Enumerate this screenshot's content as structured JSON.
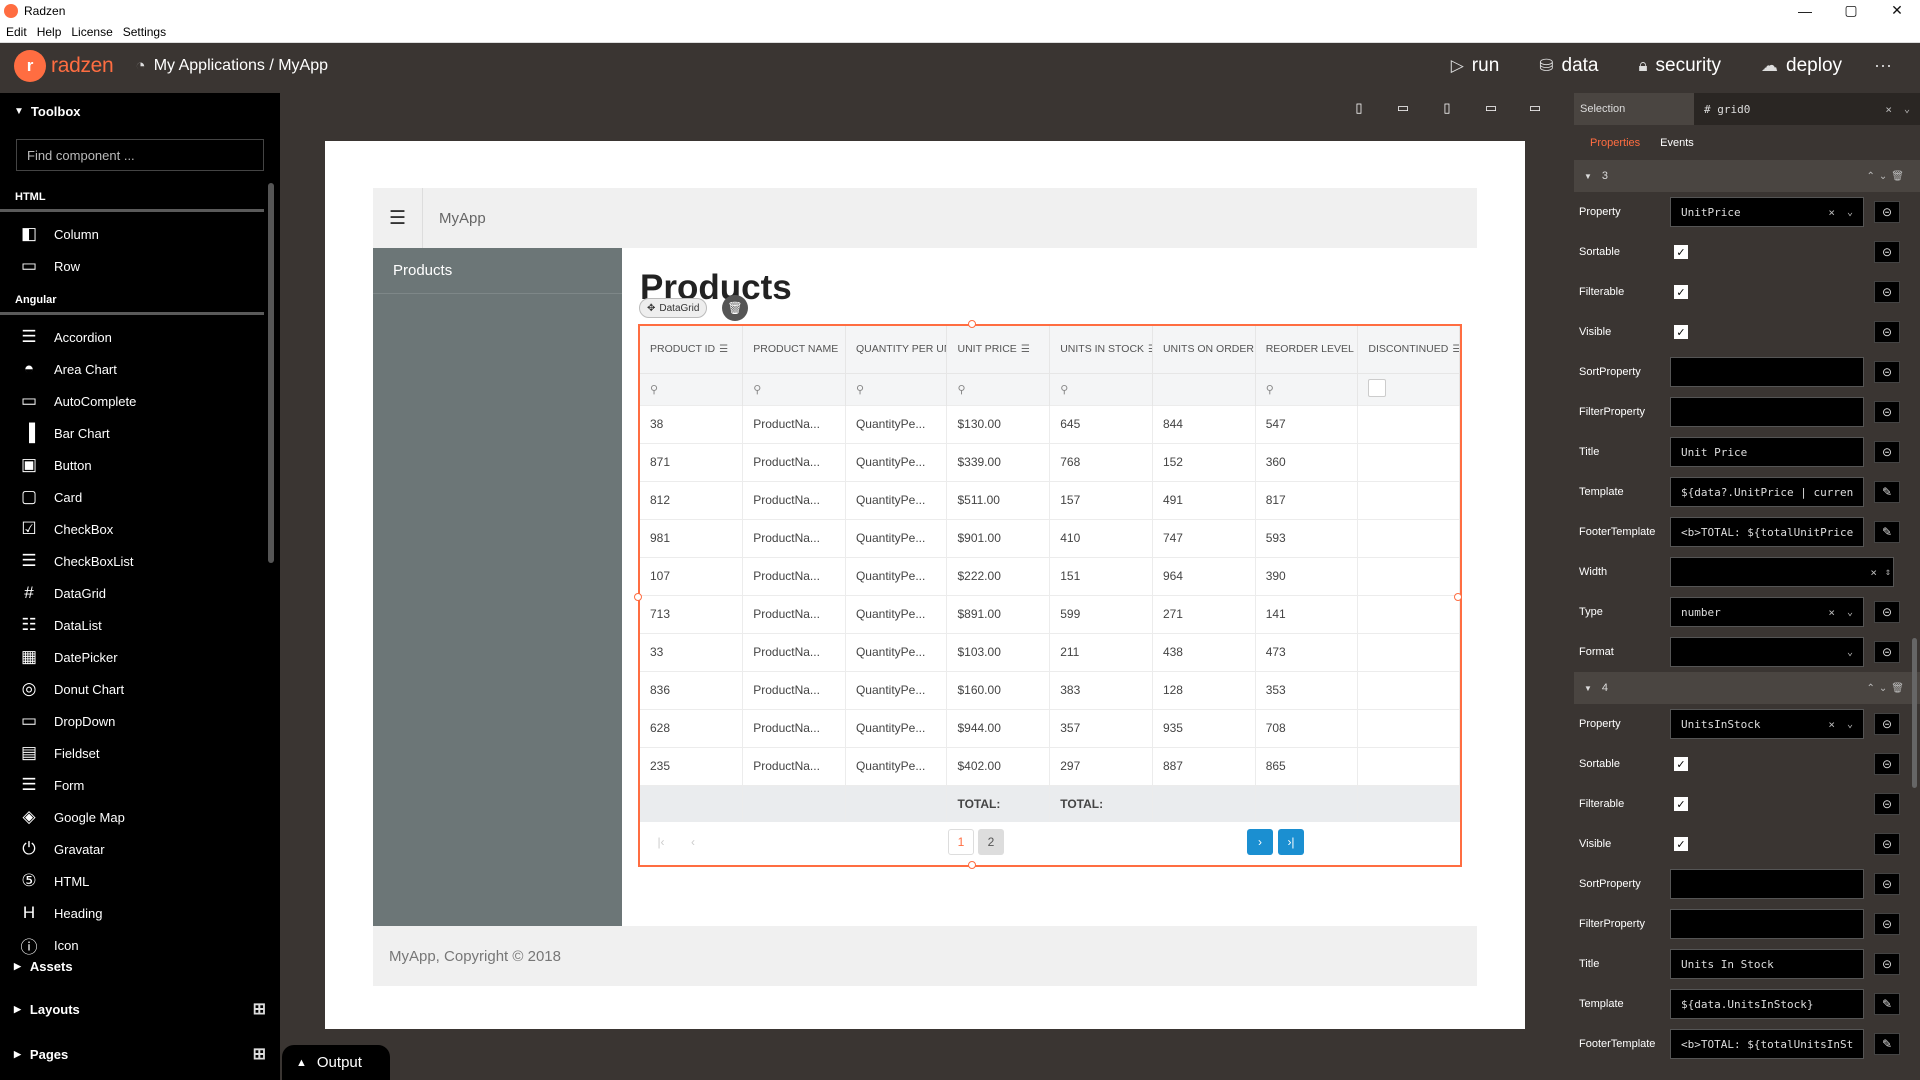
{
  "window": {
    "title": "Radzen",
    "controls": [
      "—",
      "▢",
      "✕"
    ]
  },
  "menu": [
    "Edit",
    "Help",
    "License",
    "Settings"
  ],
  "header": {
    "logo_text": "radzen",
    "breadcrumb": "My Applications / MyApp",
    "nav": [
      {
        "icon": "play-icon",
        "label": "run"
      },
      {
        "icon": "database-icon",
        "label": "data"
      },
      {
        "icon": "lock-icon",
        "label": "security"
      },
      {
        "icon": "cloud-upload-icon",
        "label": "deploy"
      }
    ],
    "more": "···"
  },
  "toolbox": {
    "title": "Toolbox",
    "search_placeholder": "Find component ...",
    "groups": [
      {
        "label": "HTML",
        "items": [
          {
            "icon": "column-icon",
            "label": "Column"
          },
          {
            "icon": "row-icon",
            "label": "Row"
          }
        ]
      },
      {
        "label": "Angular",
        "items": [
          {
            "icon": "accordion-icon",
            "label": "Accordion"
          },
          {
            "icon": "area-chart-icon",
            "label": "Area Chart"
          },
          {
            "icon": "autocomplete-icon",
            "label": "AutoComplete"
          },
          {
            "icon": "bar-chart-icon",
            "label": "Bar Chart"
          },
          {
            "icon": "button-icon",
            "label": "Button"
          },
          {
            "icon": "card-icon",
            "label": "Card"
          },
          {
            "icon": "checkbox-icon",
            "label": "CheckBox"
          },
          {
            "icon": "checkboxlist-icon",
            "label": "CheckBoxList"
          },
          {
            "icon": "datagrid-icon",
            "label": "DataGrid"
          },
          {
            "icon": "datalist-icon",
            "label": "DataList"
          },
          {
            "icon": "datepicker-icon",
            "label": "DatePicker"
          },
          {
            "icon": "donut-chart-icon",
            "label": "Donut Chart"
          },
          {
            "icon": "dropdown-icon",
            "label": "DropDown"
          },
          {
            "icon": "fieldset-icon",
            "label": "Fieldset"
          },
          {
            "icon": "form-icon",
            "label": "Form"
          },
          {
            "icon": "google-map-icon",
            "label": "Google Map"
          },
          {
            "icon": "gravatar-icon",
            "label": "Gravatar"
          },
          {
            "icon": "html5-icon",
            "label": "HTML"
          },
          {
            "icon": "heading-icon",
            "label": "Heading"
          },
          {
            "icon": "info-icon",
            "label": "Icon"
          }
        ]
      }
    ],
    "sections": [
      "Assets",
      "Layouts",
      "Pages"
    ]
  },
  "canvas": {
    "app_title": "MyApp",
    "sidebar_item": "Products",
    "heading": "Products",
    "component_badge": "DataGrid",
    "footer": "MyApp, Copyright © 2018",
    "grid": {
      "columns": [
        "PRODUCT ID",
        "PRODUCT NAME",
        "QUANTITY PER UN",
        "UNIT PRICE",
        "UNITS IN STOCK",
        "UNITS ON ORDER",
        "REORDER LEVEL",
        "DISCONTINUED"
      ],
      "rows": [
        [
          "38",
          "ProductNa...",
          "QuantityPe...",
          "$130.00",
          "645",
          "844",
          "547",
          ""
        ],
        [
          "871",
          "ProductNa...",
          "QuantityPe...",
          "$339.00",
          "768",
          "152",
          "360",
          ""
        ],
        [
          "812",
          "ProductNa...",
          "QuantityPe...",
          "$511.00",
          "157",
          "491",
          "817",
          ""
        ],
        [
          "981",
          "ProductNa...",
          "QuantityPe...",
          "$901.00",
          "410",
          "747",
          "593",
          ""
        ],
        [
          "107",
          "ProductNa...",
          "QuantityPe...",
          "$222.00",
          "151",
          "964",
          "390",
          ""
        ],
        [
          "713",
          "ProductNa...",
          "QuantityPe...",
          "$891.00",
          "599",
          "271",
          "141",
          ""
        ],
        [
          "33",
          "ProductNa...",
          "QuantityPe...",
          "$103.00",
          "211",
          "438",
          "473",
          ""
        ],
        [
          "836",
          "ProductNa...",
          "QuantityPe...",
          "$160.00",
          "383",
          "128",
          "353",
          ""
        ],
        [
          "628",
          "ProductNa...",
          "QuantityPe...",
          "$944.00",
          "357",
          "935",
          "708",
          ""
        ],
        [
          "235",
          "ProductNa...",
          "QuantityPe...",
          "$402.00",
          "297",
          "887",
          "865",
          ""
        ]
      ],
      "footer": [
        "",
        "",
        "",
        "TOTAL:",
        "TOTAL:",
        "",
        "",
        ""
      ],
      "pages": [
        "1",
        "2"
      ],
      "current_page": "1"
    }
  },
  "panel": {
    "selection_label": "Selection",
    "selection_value": "# grid0",
    "tabs": [
      "Properties",
      "Events"
    ],
    "groups": [
      {
        "index": "3",
        "rows": [
          {
            "label": "Property",
            "kind": "select",
            "value": "UnitPrice"
          },
          {
            "label": "Sortable",
            "kind": "check"
          },
          {
            "label": "Filterable",
            "kind": "check"
          },
          {
            "label": "Visible",
            "kind": "check"
          },
          {
            "label": "SortProperty",
            "kind": "text",
            "value": ""
          },
          {
            "label": "FilterProperty",
            "kind": "text",
            "value": ""
          },
          {
            "label": "Title",
            "kind": "text",
            "value": "Unit Price"
          },
          {
            "label": "Template",
            "kind": "edit",
            "value": "${data?.UnitPrice | curren"
          },
          {
            "label": "FooterTemplate",
            "kind": "edit",
            "value": "<b>TOTAL: ${totalUnitPrice"
          },
          {
            "label": "Width",
            "kind": "number",
            "value": ""
          },
          {
            "label": "Type",
            "kind": "select",
            "value": "number"
          },
          {
            "label": "Format",
            "kind": "select",
            "value": ""
          }
        ]
      },
      {
        "index": "4",
        "rows": [
          {
            "label": "Property",
            "kind": "select",
            "value": "UnitsInStock"
          },
          {
            "label": "Sortable",
            "kind": "check"
          },
          {
            "label": "Filterable",
            "kind": "check"
          },
          {
            "label": "Visible",
            "kind": "check"
          },
          {
            "label": "SortProperty",
            "kind": "text",
            "value": ""
          },
          {
            "label": "FilterProperty",
            "kind": "text",
            "value": ""
          },
          {
            "label": "Title",
            "kind": "text",
            "value": "Units In Stock"
          },
          {
            "label": "Template",
            "kind": "edit",
            "value": "${data.UnitsInStock}"
          },
          {
            "label": "FooterTemplate",
            "kind": "edit",
            "value": "<b>TOTAL: ${totalUnitsInSt"
          }
        ]
      }
    ]
  },
  "output_label": "Output",
  "colors": {
    "accent": "#ff6d41",
    "dark": "#3a3532",
    "sidebar": "#6c7677"
  }
}
